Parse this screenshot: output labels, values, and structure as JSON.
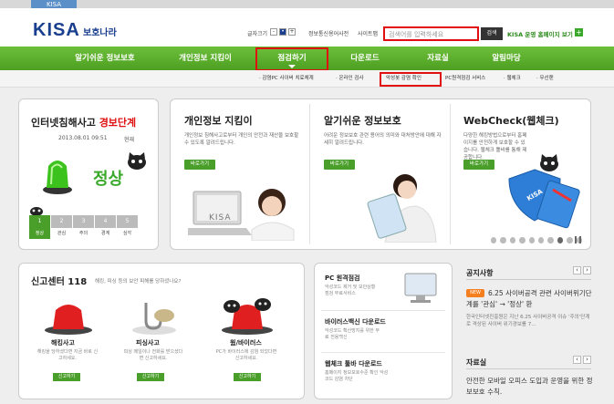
{
  "top": {
    "tab": "KISA"
  },
  "header": {
    "logo": "KISA",
    "logo_sub": "보호나라",
    "font_label": "글자크기",
    "font_minus": "-",
    "font_dot": "•",
    "font_plus": "+",
    "links": [
      "정보통신용어사전",
      "사이트맵"
    ],
    "search_placeholder": "검색어를 입력하세요",
    "search_button": "검색",
    "portal_label": "KISA 운영 홈페이지 보기",
    "portal_plus": "+"
  },
  "nav": [
    "알기쉬운 정보보호",
    "개인정보 지킴이",
    "점검하기",
    "다운로드",
    "자료실",
    "알림마당"
  ],
  "subnav": [
    "· 감염PC 사이버 치료체계",
    "· 온라인 검사",
    "악성봇 감염 확인",
    "PC원격점검 서비스",
    "· 웹체크",
    "· 무선랜"
  ],
  "alert": {
    "title_a": "인터넷침해사고",
    "title_b": "경보단계",
    "date": "2013.08.01 09:51",
    "now": "현재",
    "status": "정상",
    "steps": [
      "1",
      "2",
      "3",
      "4",
      "5"
    ],
    "labels": [
      "정상",
      "관심",
      "주의",
      "경계",
      "심각"
    ]
  },
  "cards": [
    {
      "title": "개인정보 지킴이",
      "desc": "개인정보 침해사고로부터 개인의 안전과 재산을 보호할 수 있도록 알려드립니다.",
      "btn": "바로가기",
      "img": "KISA"
    },
    {
      "title": "알기쉬운 정보보호",
      "desc": "어려운 정보보호 관련 용어의 의미와 대처방안에 대해 자세히 알려드립니다.",
      "btn": "바로가기"
    },
    {
      "title": "WebCheck(웹체크)",
      "desc": "다양한 해킹방법으로부터 홈페이지를 안전하게 보호할 수 있습니다. 웹체크 툴바를 통해 제공합니다.",
      "btn": "바로가기",
      "img": "KISA"
    }
  ],
  "report": {
    "title": "신고센터 118",
    "subtitle": "해킹, 피싱 등의 보안 피해를 당하셨나요?",
    "items": [
      {
        "title": "해킹사고",
        "desc": "해킹을 당하셨다면 지금 바로 신고하세요.",
        "btn": "신고하기"
      },
      {
        "title": "피싱사고",
        "desc": "피싱 메일이나 전화를 받으셨다면 신고하세요.",
        "btn": "신고하기"
      },
      {
        "title": "웜/바이러스",
        "desc": "PC가 바이러스에 감염 되었다면 신고하세요.",
        "btn": "신고하기"
      }
    ]
  },
  "services": [
    {
      "title": "PC 원격점검",
      "desc": "악성코드 제거 및 보안상황 점검 무료서비스"
    },
    {
      "title": "바이러스백신 다운로드",
      "desc": "악성코드 확산방지를 위한 무료 전용백신"
    },
    {
      "title": "웹체크 툴바 다운로드",
      "desc": "홈페이지 정보보호수준 확인 악성코드 감염 차단"
    }
  ],
  "notice": {
    "title": "공지사항",
    "new": "NEW",
    "headline": "6.25 사이버공격 관련 사이버위기단계를 '관심' → '정상' 환",
    "body": "한국인터넷진흥원은 지난 6.25 사이버공격 이슈 '주의'단계로 격상된 사이버 위기경보를 7..."
  },
  "library": {
    "title": "자료실",
    "body": "안전한 모바일 오피스 도입과 운영을 위한 정보보호 수칙."
  },
  "colors": {
    "green": "#4e9f22",
    "red": "#e01010",
    "navy": "#1a3f8f"
  }
}
